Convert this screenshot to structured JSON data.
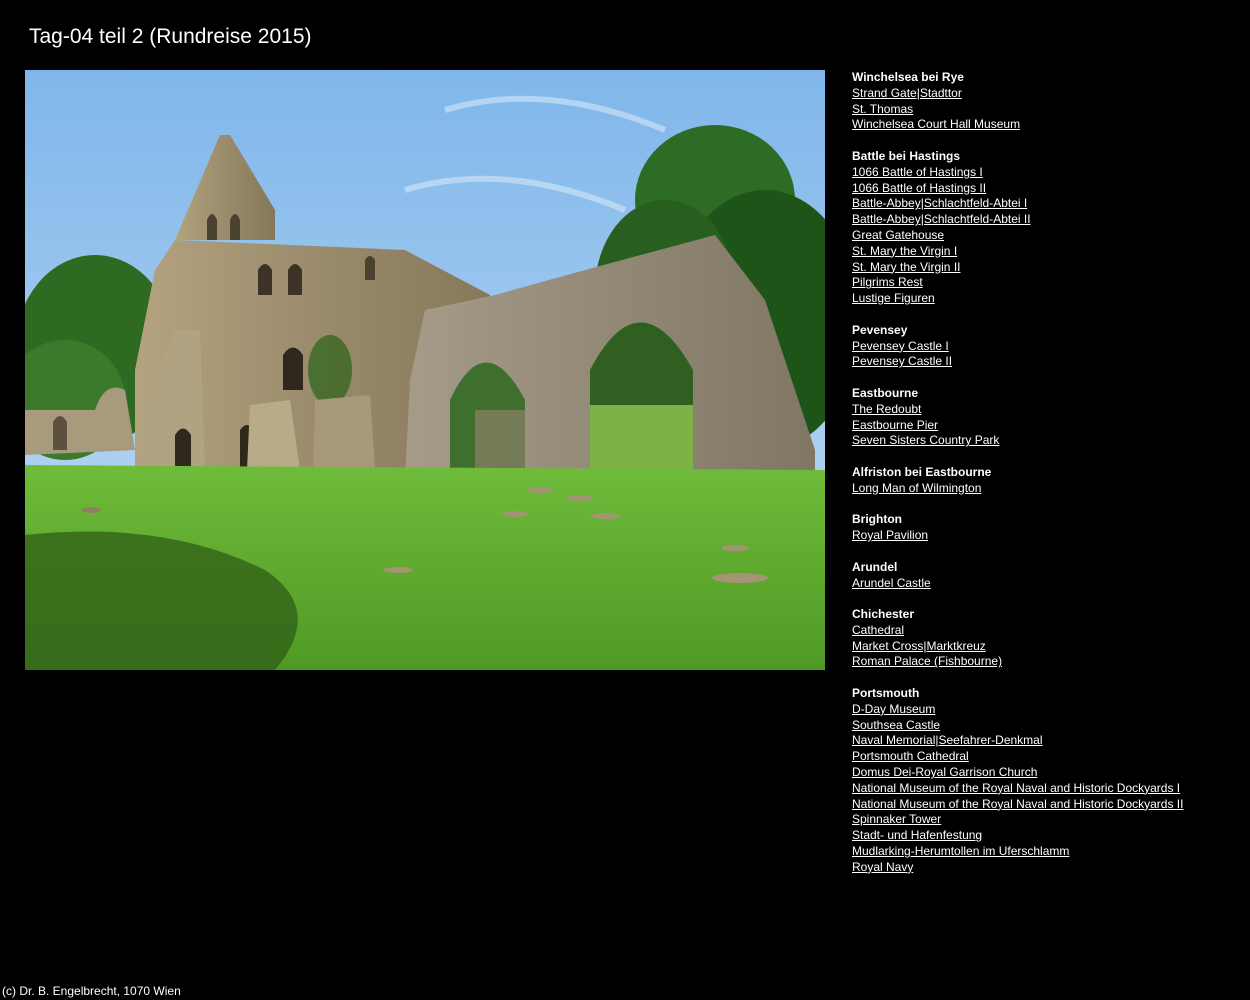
{
  "page": {
    "title": "Tag-04 teil 2 (Rundreise 2015)",
    "footer": "(c) Dr. B. Engelbrecht, 1070 Wien"
  },
  "colors": {
    "background": "#000000",
    "text": "#ffffff",
    "sky": "#8fc3ec",
    "grass": "#5fae2e",
    "stone": "#9c8d70"
  },
  "nav": {
    "groups": [
      {
        "heading": "Winchelsea bei Rye",
        "links": [
          "Strand Gate|Stadttor",
          "St. Thomas",
          "Winchelsea Court Hall Museum"
        ]
      },
      {
        "heading": "Battle bei Hastings",
        "links": [
          "1066 Battle of Hastings I",
          "1066 Battle of Hastings II",
          "Battle-Abbey|Schlachtfeld-Abtei I",
          "Battle-Abbey|Schlachtfeld-Abtei II",
          "Great Gatehouse",
          "St. Mary the Virgin I",
          "St. Mary the Virgin II",
          "Pilgrims Rest",
          "Lustige Figuren"
        ]
      },
      {
        "heading": "Pevensey",
        "links": [
          "Pevensey Castle I",
          "Pevensey Castle II"
        ]
      },
      {
        "heading": "Eastbourne",
        "links": [
          "The Redoubt",
          "Eastbourne Pier",
          "Seven Sisters Country Park"
        ]
      },
      {
        "heading": "Alfriston bei Eastbourne",
        "links": [
          "Long Man of Wilmington"
        ]
      },
      {
        "heading": "Brighton",
        "links": [
          "Royal Pavilion"
        ]
      },
      {
        "heading": "Arundel",
        "links": [
          "Arundel Castle"
        ]
      },
      {
        "heading": "Chichester",
        "links": [
          "Cathedral",
          "Market Cross|Marktkreuz",
          "Roman Palace (Fishbourne)"
        ]
      },
      {
        "heading": "Portsmouth",
        "links": [
          "D-Day Museum",
          "Southsea Castle",
          "Naval Memorial|Seefahrer-Denkmal",
          "Portsmouth Cathedral",
          "Domus Dei-Royal Garrison Church",
          "National Museum of the Royal Naval and Historic Dockyards I",
          "National Museum of the Royal Naval and Historic Dockyards II",
          "Spinnaker Tower",
          "Stadt- und Hafenfestung",
          "Mudlarking-Herumtollen im Uferschlamm",
          "Royal Navy"
        ]
      }
    ]
  }
}
